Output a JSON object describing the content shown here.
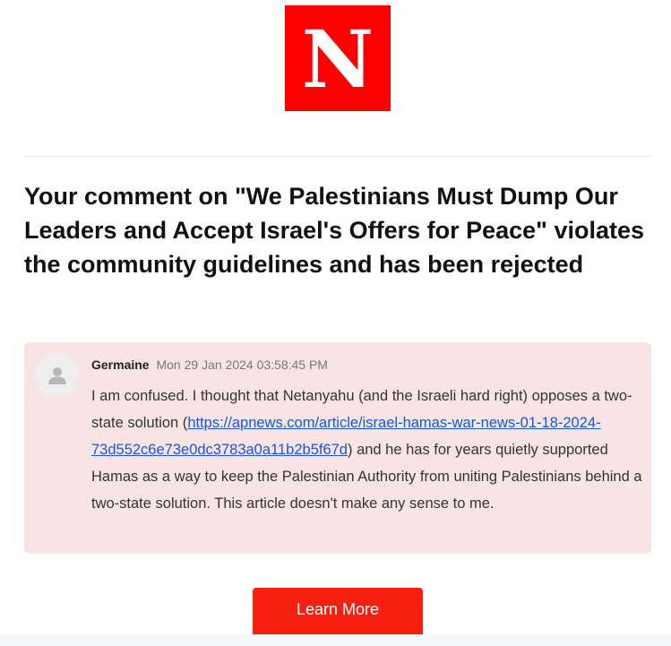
{
  "brand": {
    "logo_letter": "N",
    "logo_color": "#ff0000"
  },
  "headline": "Your comment on \"We Palestinians Must Dump Our Leaders and Accept Israel's Offers for Peace\" violates the community guidelines and has been rejected",
  "comment": {
    "author": "Germaine",
    "timestamp": "Mon 29 Jan 2024 03:58:45 PM",
    "avatar_icon": "user-icon",
    "text_before_link": "I am confused. I thought that Netanyahu (and the Israeli hard right) opposes a two-state solution (",
    "link_text": "https://apnews.com/article/israel-hamas-war-news-01-18-2024-73d552c6e73e0dc3783a0a11b2b5f67d",
    "text_after_link": ") and he has for years quietly supported Hamas as a way to keep the Palestinian Authority from uniting Palestinians behind a two-state solution. This article doesn't make any sense to me.",
    "background_color": "#f9e4e4",
    "link_color": "#1a55d6"
  },
  "cta": {
    "label": "Learn More",
    "color": "#f5200f"
  }
}
